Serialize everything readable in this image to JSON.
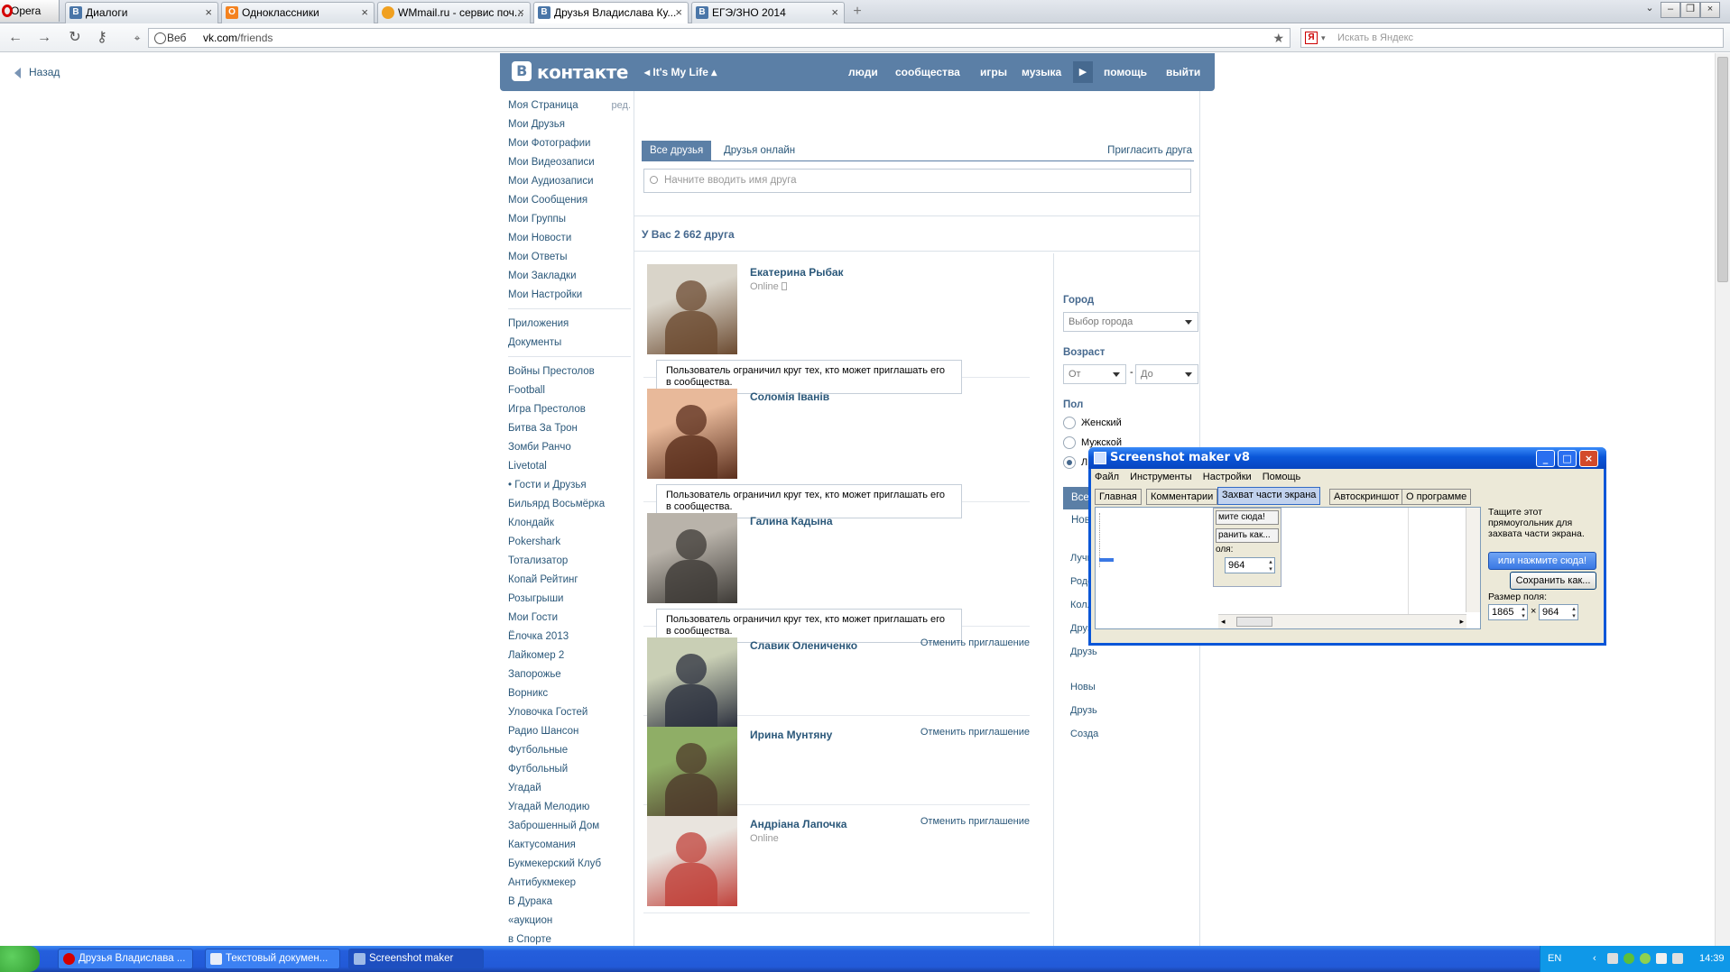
{
  "browser": {
    "menu_label": "Opera",
    "tabs": [
      {
        "title": "Диалоги",
        "icon": "vk-icon",
        "color": "#4a76a8"
      },
      {
        "title": "Одноклассники",
        "icon": "ok-icon",
        "color": "#f4821f"
      },
      {
        "title": "WMmail.ru - сервис поч...",
        "icon": "wmmail-icon",
        "color": "#f0a020"
      },
      {
        "title": "Друзья Владислава Ку...",
        "icon": "vk-icon",
        "color": "#4a76a8",
        "active": true
      },
      {
        "title": "ЕГЭ/ЗНО 2014",
        "icon": "vk-icon",
        "color": "#4a76a8"
      }
    ],
    "address": {
      "scheme_label": "Веб",
      "host": "vk.com",
      "path": "/friends"
    },
    "search_placeholder": "Искать в Яндекс"
  },
  "page": {
    "back_label": "Назад",
    "header": {
      "logo_text": "контакте",
      "status": "It's My Life",
      "nav": [
        "люди",
        "сообщества",
        "игры",
        "музыка",
        "помощь",
        "выйти"
      ]
    },
    "left_menu": {
      "main": [
        "Моя Страница",
        "Мои Друзья",
        "Мои Фотографии",
        "Мои Видеозаписи",
        "Мои Аудиозаписи",
        "Мои Сообщения",
        "Мои Группы",
        "Мои Новости",
        "Мои Ответы",
        "Мои Закладки",
        "Мои Настройки"
      ],
      "edit_label": "ред.",
      "apps": [
        "Приложения",
        "Документы"
      ],
      "games": [
        "Войны Престолов",
        "Football",
        "Игра Престолов",
        "Битва За Трон",
        "Зомби Ранчо",
        "Livetotal",
        "• Гости и Друзья",
        "Бильярд Восьмёрка",
        "Клондайк",
        "Pokershark",
        "Тотализатор",
        "Копай Рейтинг",
        "Розыгрыши",
        "Мои Гости",
        "Ёлочка 2013",
        "Лайкомер 2",
        "Запорожье",
        "Ворникс",
        "Уловочка Гостей",
        "Радио Шансон",
        "Футбольные",
        "Футбольный",
        "Угадай",
        "Угадай Мелодию",
        "Заброшенный Дом",
        "Кактусомания",
        "Букмекерский Клуб",
        "Антибукмекер",
        "В Дурака",
        "«аукцион",
        "в Спорте"
      ]
    },
    "tabs": [
      "Все друзья",
      "Друзья онлайн"
    ],
    "invite_label": "Пригласить друга",
    "search_placeholder": "Начните вводить имя друга",
    "count_text": "У Вас 2 662 друга",
    "friends": [
      {
        "name": "Екатерина Рыбак",
        "status": "Online",
        "note": "Пользователь ограничил круг тех, кто может приглашать его в сообщества.",
        "colors": [
          "#d9d4c9",
          "#6b4a30"
        ]
      },
      {
        "name": "Соломія Іванів",
        "status": "",
        "note": "Пользователь ограничил круг тех, кто может приглашать его в сообщества.",
        "colors": [
          "#e8b99a",
          "#5a2e1c"
        ]
      },
      {
        "name": "Галина Кадына",
        "status": "",
        "note": "Пользователь ограничил круг тех, кто может приглашать его в сообщества.",
        "colors": [
          "#b9b3aa",
          "#3d3a36"
        ]
      },
      {
        "name": "Славик Олениченко",
        "status": "",
        "cancel": "Отменить приглашение",
        "colors": [
          "#c9cfb5",
          "#2b2f3d"
        ]
      },
      {
        "name": "Ирина Мунтяну",
        "status": "",
        "cancel": "Отменить приглашение",
        "colors": [
          "#8fae66",
          "#4d3a2a"
        ]
      },
      {
        "name": "Андріана Лапочка",
        "status": "Online",
        "cancel": "Отменить приглашение",
        "colors": [
          "#e9e4de",
          "#c0413a"
        ]
      }
    ],
    "filters": {
      "city_title": "Город",
      "city_placeholder": "Выбор города",
      "age_title": "Возраст",
      "age_from": "От",
      "age_dash": "-",
      "age_to": "До",
      "sex_title": "Пол",
      "sex_options": [
        "Женский",
        "Мужской",
        "Любой"
      ],
      "sex_selected": "Любой",
      "menu": [
        "Все друзья",
        "Новые друзья"
      ],
      "menu_partial": [
        "Лучш",
        "Родст",
        "Колле",
        "Друзь",
        "Друзь",
        "Новы",
        "Друзь",
        "Созда"
      ]
    }
  },
  "screenshot_maker": {
    "title": "Screenshot maker v8",
    "menu": [
      "Файл",
      "Инструменты",
      "Настройки",
      "Помощь"
    ],
    "tabs": [
      "Главная",
      "Комментарии",
      "Захват части экрана",
      "Автоскриншот",
      "О программе"
    ],
    "active_tab": "Захват части экрана",
    "mini_texts": [
      "мите сюда!",
      "ранить как...",
      "оля:",
      "964"
    ],
    "hint": "Тащите этот прямоугольник для захвата части экрана.",
    "click_button": "или нажмите сюда!",
    "save_button": "Сохранить как...",
    "size_label": "Размер поля:",
    "width": "1865",
    "height": "964"
  },
  "taskbar": {
    "items": [
      {
        "label": "Друзья Владислава ...",
        "color": "#d40000"
      },
      {
        "label": "Текстовый докумен...",
        "color": "#e8eef8"
      },
      {
        "label": "Screenshot maker",
        "color": "#9fbbe8",
        "active": true
      }
    ],
    "lang": "EN",
    "clock": "14:39"
  }
}
